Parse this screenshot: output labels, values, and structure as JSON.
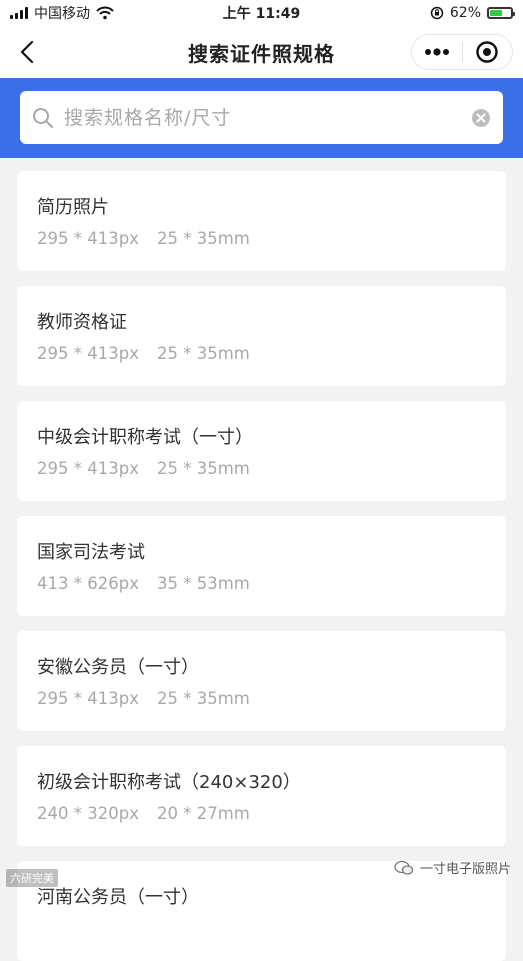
{
  "status_bar": {
    "carrier": "中国移动",
    "time": "上午 11:49",
    "battery": "62%",
    "battery_level": 0.62
  },
  "nav": {
    "title": "搜索证件照规格"
  },
  "search": {
    "placeholder": "搜索规格名称/尺寸",
    "value": ""
  },
  "specs": [
    {
      "name": "简历照片",
      "px": "295 * 413px",
      "mm": "25 * 35mm"
    },
    {
      "name": "教师资格证",
      "px": "295 * 413px",
      "mm": "25 * 35mm"
    },
    {
      "name": "中级会计职称考试（一寸）",
      "px": "295 * 413px",
      "mm": "25 * 35mm"
    },
    {
      "name": "国家司法考试",
      "px": "413 * 626px",
      "mm": "35 * 53mm"
    },
    {
      "name": "安徽公务员（一寸）",
      "px": "295 * 413px",
      "mm": "25 * 35mm"
    },
    {
      "name": "初级会计职称考试（240×320）",
      "px": "240 * 320px",
      "mm": "20 * 27mm"
    },
    {
      "name": "河南公务员（一寸）",
      "px": "",
      "mm": ""
    }
  ],
  "watermarks": {
    "left": "六研完美",
    "right": "一寸电子版照片"
  }
}
